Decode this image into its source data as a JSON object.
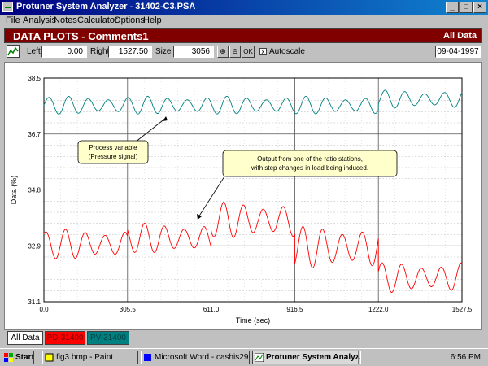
{
  "window": {
    "title": "Protuner System Analyzer - 31402-C3.PSA"
  },
  "menu": [
    "File",
    "Analysis",
    "Notes",
    "Calculator",
    "Options",
    "Help"
  ],
  "header": {
    "title": "DATA PLOTS - Comments1",
    "right": "All Data"
  },
  "toolbar": {
    "left_label": "Left",
    "left_value": "0.00",
    "right_label": "Right",
    "right_value": "1527.50",
    "size_label": "Size",
    "size_value": "3056",
    "ok_label": "OK",
    "autoscale_label": "Autoscale",
    "date": "09-04-1997"
  },
  "chart_data": {
    "type": "line",
    "xlabel": "Time (sec)",
    "ylabel": "Data (%)",
    "xlim": [
      0,
      1527.5
    ],
    "ylim": [
      31.1,
      38.5
    ],
    "x_ticks": [
      "0.0",
      "305.5",
      "611.0",
      "916.5",
      "1222.0",
      "1527.5"
    ],
    "y_ticks": [
      "31.1",
      "32.9",
      "34.8",
      "36.7",
      "38.5"
    ],
    "grid": true,
    "series": [
      {
        "name": "PV-31400",
        "color": "#008080",
        "segments": [
          {
            "x0": 0,
            "x1": 916.5,
            "mean": 37.6,
            "amp": 0.3
          },
          {
            "x0": 916.5,
            "x1": 1222,
            "mean": 37.6,
            "amp": 0.3
          },
          {
            "x0": 1222,
            "x1": 1527.5,
            "mean": 37.8,
            "amp": 0.3
          }
        ]
      },
      {
        "name": "PD-31400",
        "color": "#ff0000",
        "segments": [
          {
            "x0": 0,
            "x1": 305.5,
            "mean": 33.0,
            "amp": 0.5
          },
          {
            "x0": 305.5,
            "x1": 611,
            "mean": 33.2,
            "amp": 0.5
          },
          {
            "x0": 611,
            "x1": 916.5,
            "mean": 33.8,
            "amp": 0.6
          },
          {
            "x0": 916.5,
            "x1": 1222,
            "mean": 32.9,
            "amp": 0.7
          },
          {
            "x0": 1222,
            "x1": 1527.5,
            "mean": 31.9,
            "amp": 0.5
          }
        ]
      }
    ],
    "annotations": [
      {
        "text": [
          "Process variable",
          "(Pressure signal)"
        ]
      },
      {
        "text": [
          "Output from one of the ratio stations,",
          "with step changes in load being induced."
        ]
      }
    ]
  },
  "tabs": [
    "All Data",
    "PD-31400",
    "PV-31400"
  ],
  "taskbar": {
    "start": "Start",
    "tasks": [
      "fig3.bmp - Paint",
      "Microsoft Word - cashis29...",
      "Protuner System Analyz..."
    ],
    "clock": "6:56 PM"
  },
  "colors": {
    "header_bg": "#800000",
    "titlebar": "#000080",
    "pd_tab": "#ff0000",
    "pv_tab": "#008080"
  },
  "icons": [
    "app-icon",
    "minimize-icon",
    "maximize-icon",
    "close-icon",
    "plot-icon",
    "zoom-in-icon",
    "zoom-out-icon",
    "paint-icon",
    "word-icon"
  ]
}
